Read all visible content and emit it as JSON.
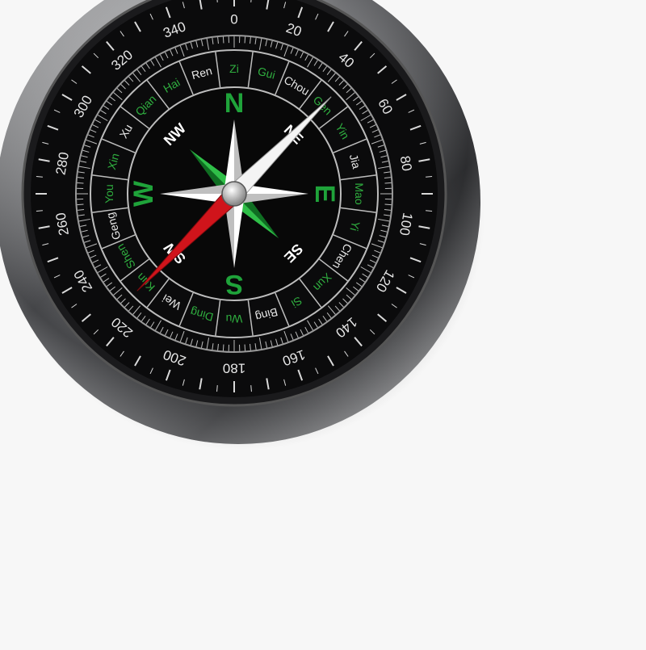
{
  "compass": {
    "cardinals": [
      {
        "label": "N",
        "angle": 0
      },
      {
        "label": "E",
        "angle": 90
      },
      {
        "label": "S",
        "angle": 180
      },
      {
        "label": "W",
        "angle": 270
      }
    ],
    "intercardinals": [
      {
        "label": "NE",
        "angle": 45
      },
      {
        "label": "SE",
        "angle": 135
      },
      {
        "label": "SW",
        "angle": 225
      },
      {
        "label": "NW",
        "angle": 315
      }
    ],
    "degree_labels": [
      "0",
      "20",
      "40",
      "60",
      "80",
      "100",
      "120",
      "140",
      "160",
      "180",
      "200",
      "220",
      "240",
      "260",
      "280",
      "300",
      "320",
      "340"
    ],
    "ring_labels": [
      "Zi",
      "Gui",
      "Chou",
      "Gen",
      "Yin",
      "Jia",
      "Mao",
      "Yi",
      "Chen",
      "Xun",
      "Si",
      "Bing",
      "Wu",
      "Ding",
      "Wei",
      "Kun",
      "Shen",
      "Geng",
      "You",
      "Xin",
      "Xu",
      "Qian",
      "Hai",
      "Ren"
    ],
    "needle_heading_deg": 45,
    "colors": {
      "background": "#f7f7f7",
      "bezel": "#6d6d70",
      "dial": "#0b0b0c",
      "cardinal": "#1fa33a",
      "ring_text_green": "#2fae3f",
      "ring_text_white": "#e8e8e8",
      "needle_north": "#f4f4f4",
      "needle_south": "#d0141b"
    }
  }
}
